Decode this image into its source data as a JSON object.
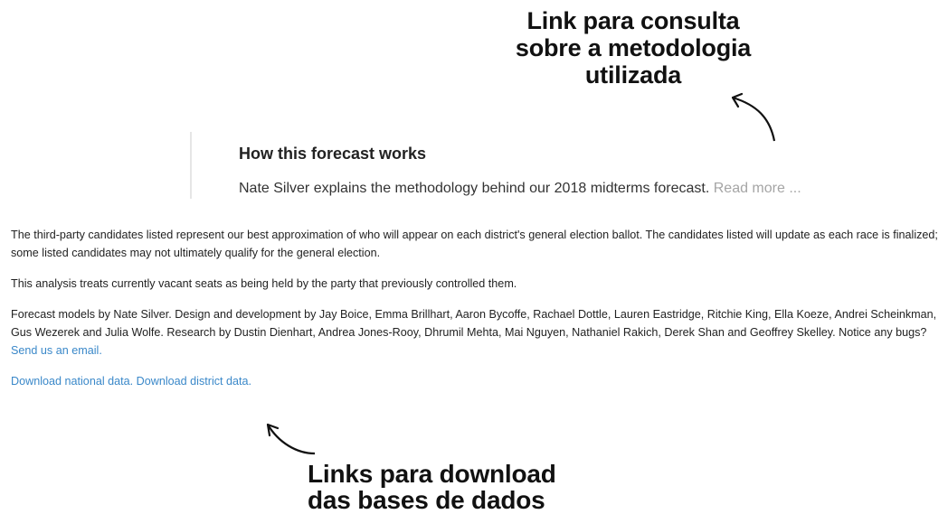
{
  "annotations": {
    "methodology_lines": [
      "Link para consulta",
      "sobre a metodologia",
      "utilizada"
    ],
    "download_lines": [
      "Links para download",
      "das bases de dados"
    ]
  },
  "callout": {
    "title": "How this forecast works",
    "text": "Nate Silver explains the methodology behind our 2018 midterms forecast.",
    "read_more": "Read more ..."
  },
  "notes": {
    "third_party": "The third-party candidates listed represent our best approximation of who will appear on each district's general election ballot. The candidates listed will update as each race is finalized; some listed candidates may not ultimately qualify for the general election.",
    "vacant": "This analysis treats currently vacant seats as being held by the party that previously controlled them.",
    "credits": "Forecast models by Nate Silver. Design and development by Jay Boice, Emma Brillhart, Aaron Bycoffe, Rachael Dottle, Lauren Eastridge, Ritchie King, Ella Koeze, Andrei Scheinkman, Gus Wezerek and Julia Wolfe. Research by Dustin Dienhart, Andrea Jones-Rooy, Dhrumil Mehta, Mai Nguyen, Nathaniel Rakich, Derek Shan and Geoffrey Skelley. Notice any bugs?",
    "email_link": "Send us an email.",
    "download_national": "Download national data.",
    "download_district": "Download district data."
  },
  "colors": {
    "link": "#3a88c9",
    "read_more": "#a5a5a5",
    "divider": "#e6e6e6"
  }
}
